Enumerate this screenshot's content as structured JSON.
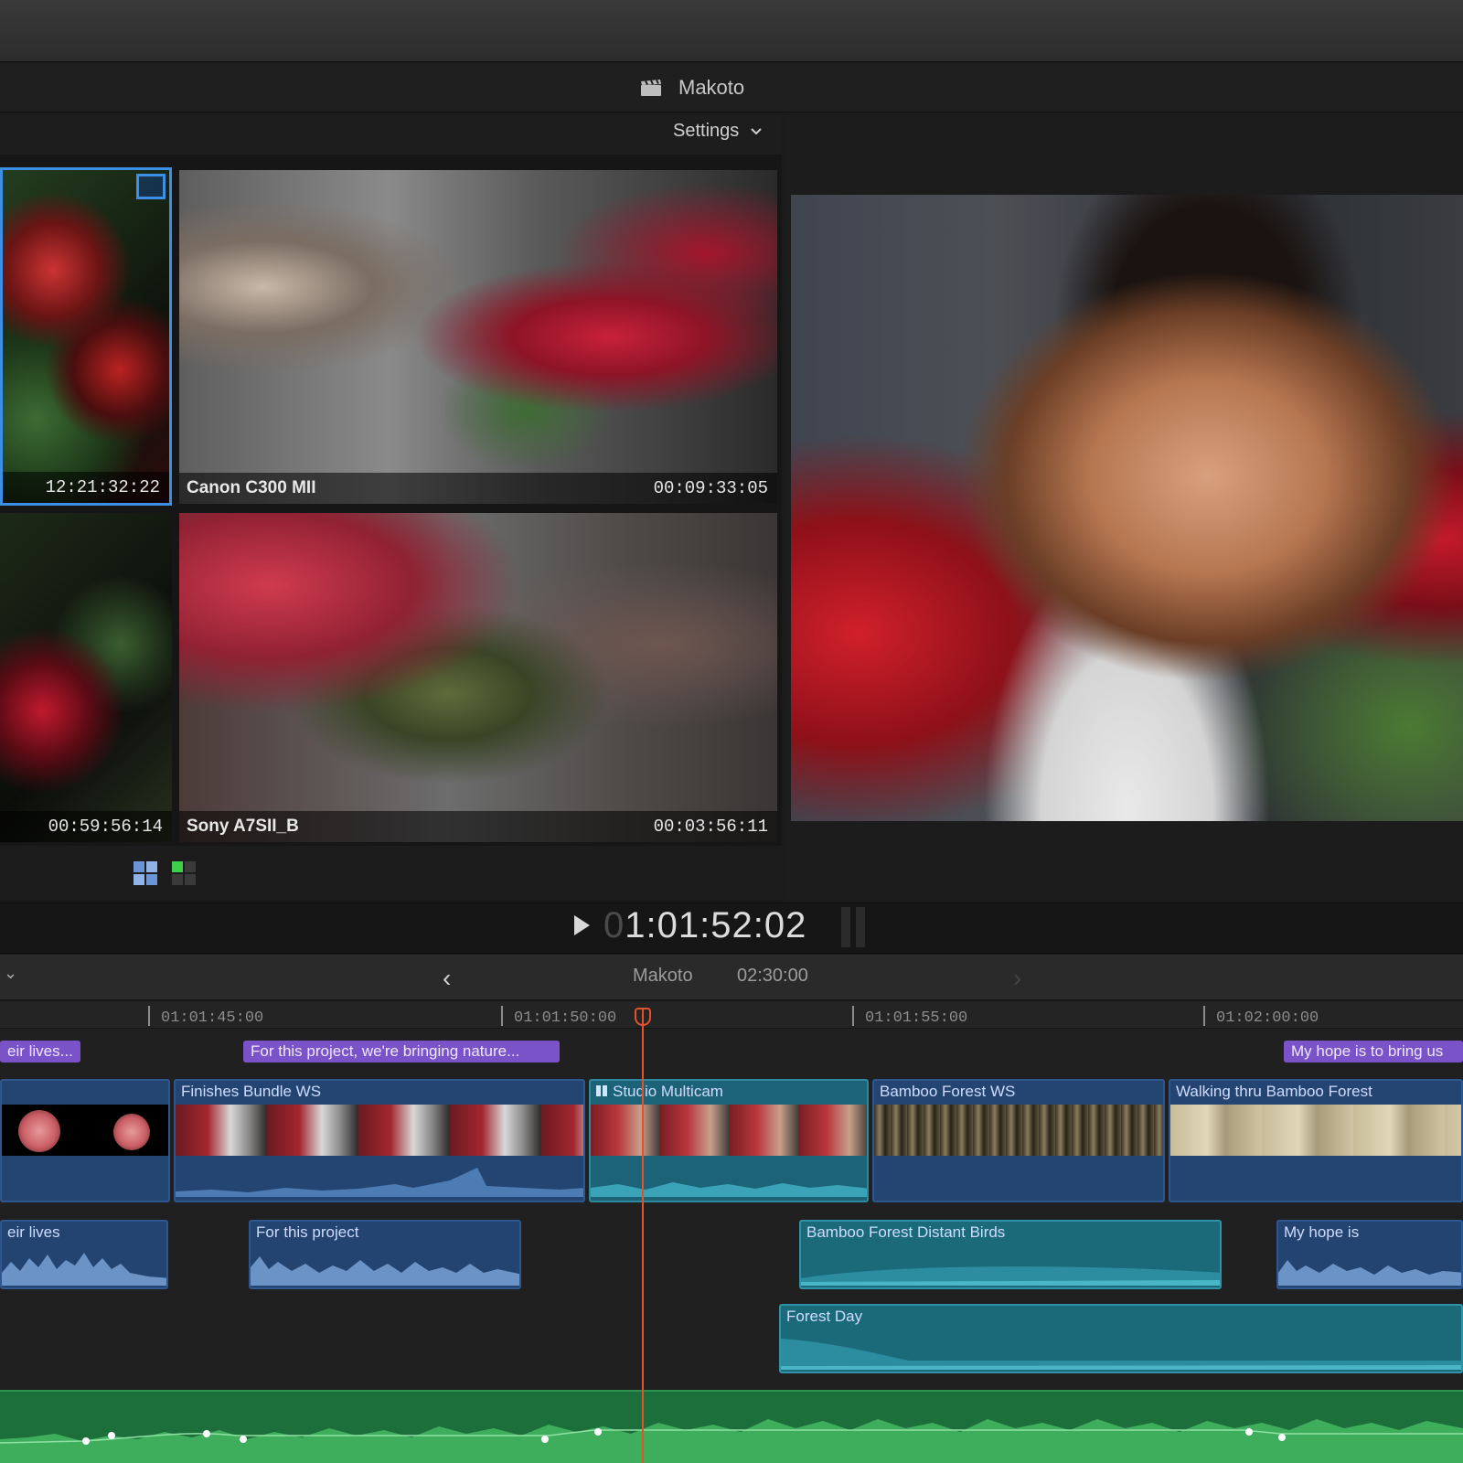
{
  "window": {
    "title": "Makoto"
  },
  "angle_viewer": {
    "settings_label": "Settings",
    "angles": [
      {
        "name": "",
        "timecode": "12:21:32:22"
      },
      {
        "name": "Canon C300 MII",
        "timecode": "00:09:33:05"
      },
      {
        "name": "",
        "timecode": "00:59:56:14"
      },
      {
        "name": "Sony A7SII_B",
        "timecode": "00:03:56:11"
      }
    ]
  },
  "transport": {
    "timecode_dim": "0",
    "timecode": "1:01:52:02"
  },
  "timeline_header": {
    "back": "‹",
    "project": "Makoto",
    "duration": "02:30:00",
    "forward": "›",
    "menu": "⌄"
  },
  "ruler": [
    "01:01:45:00",
    "01:01:50:00",
    "01:01:55:00",
    "01:02:00:00"
  ],
  "markers": [
    {
      "text": "eir lives..."
    },
    {
      "text": "For this project, we're bringing nature..."
    },
    {
      "text": "My hope is to bring us"
    }
  ],
  "video_clips": [
    {
      "name": ""
    },
    {
      "name": "Finishes Bundle WS"
    },
    {
      "name": "Studio Multicam"
    },
    {
      "name": "Bamboo Forest WS"
    },
    {
      "name": "Walking thru Bamboo Forest"
    }
  ],
  "audio_clips": [
    {
      "name": "eir lives"
    },
    {
      "name": "For this project"
    },
    {
      "name": "Bamboo Forest Distant Birds"
    },
    {
      "name": "My hope is"
    },
    {
      "name": "Forest Day"
    }
  ],
  "colors": {
    "accent": "#3d8fe6",
    "marker": "#7b53c9",
    "playhead": "#e0532c",
    "clip_blue": "#244572",
    "clip_teal": "#1b6a7a",
    "music_green": "#1c6e3a"
  }
}
